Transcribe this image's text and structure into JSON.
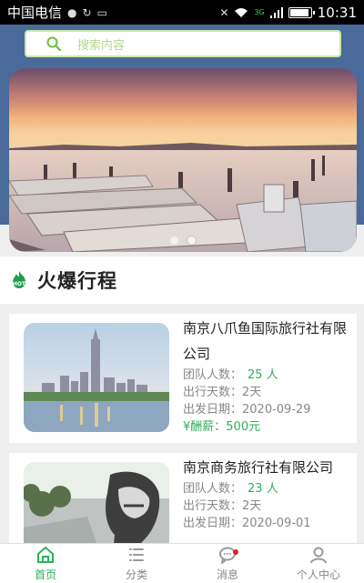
{
  "status_bar": {
    "carrier": "中国电信",
    "time": "10:31",
    "signal_label": "3G",
    "battery_level": 0.85
  },
  "search": {
    "placeholder": "搜索内容"
  },
  "banner": {
    "slide_count": 2,
    "active_slide": 1
  },
  "section": {
    "title": "火爆行程",
    "badge_text": "HOT"
  },
  "trips": [
    {
      "name": "南京八爪鱼国际旅行社有限公司",
      "team_label": "团队人数：",
      "team_size": "25 人",
      "days_label": "出行天数：",
      "days": "2天",
      "date_label": "出发日期：",
      "date": "2020-09-29",
      "fee": "¥酬薪：500元"
    },
    {
      "name": "南京商务旅行社有限公司",
      "team_label": "团队人数：",
      "team_size": "23 人",
      "days_label": "出行天数：",
      "days": "2天",
      "date_label": "出发日期：",
      "date": "2020-09-01"
    }
  ],
  "tabs": [
    {
      "label": "首页",
      "icon": "home-icon",
      "active": true
    },
    {
      "label": "分类",
      "icon": "list-icon",
      "active": false
    },
    {
      "label": "消息",
      "icon": "message-icon",
      "active": false,
      "has_badge": true
    },
    {
      "label": "个人中心",
      "icon": "user-icon",
      "active": false
    }
  ],
  "colors": {
    "accent": "#2faf5b",
    "header_blue": "#4a6a9a",
    "search_border": "#cde7a8",
    "badge_red": "#e02020"
  }
}
